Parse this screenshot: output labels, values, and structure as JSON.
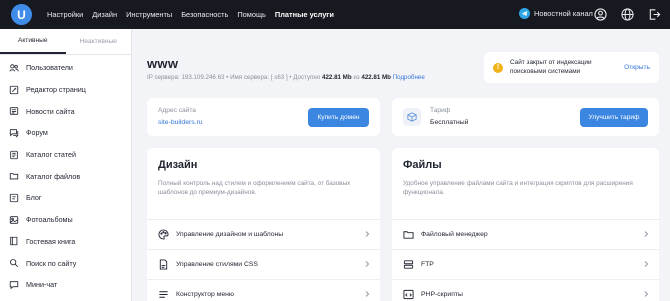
{
  "app": {
    "logo_letter": "U"
  },
  "topnav": {
    "items": [
      "Настройки",
      "Дизайн",
      "Инструменты",
      "Безопасность",
      "Помощь"
    ],
    "paid": "Платные услуги",
    "telegram": "Новостной канал"
  },
  "sidebar": {
    "tab_active": "Активные",
    "tab_inactive": "Неактивные",
    "items": [
      {
        "label": "Пользователи",
        "icon": "users-icon"
      },
      {
        "label": "Редактор страниц",
        "icon": "page-editor-icon"
      },
      {
        "label": "Новости сайта",
        "icon": "news-icon"
      },
      {
        "label": "Форум",
        "icon": "forum-icon"
      },
      {
        "label": "Каталог статей",
        "icon": "articles-icon"
      },
      {
        "label": "Каталог файлов",
        "icon": "files-catalog-icon"
      },
      {
        "label": "Блог",
        "icon": "blog-icon"
      },
      {
        "label": "Фотоальбомы",
        "icon": "photo-icon"
      },
      {
        "label": "Гостевая книга",
        "icon": "guestbook-icon"
      },
      {
        "label": "Поиск по сайту",
        "icon": "search-icon"
      },
      {
        "label": "Мини-чат",
        "icon": "chat-icon"
      }
    ]
  },
  "site": {
    "name": "www",
    "ip_label": "IP сервера:",
    "ip": "193.109.246.63",
    "server_label": "Имя сервера:",
    "server": "[ s63 ]",
    "available_label": "Доступно",
    "available": "422.81 Mb",
    "of": "из",
    "total": "422.81 Mb",
    "more": "Подробнее"
  },
  "notice": {
    "text": "Сайт закрыт от индексации поисковыми системами",
    "action": "Открыть"
  },
  "address": {
    "label": "Адрес сайта",
    "value": "site-builders.ru",
    "button": "Купить домен"
  },
  "tariff": {
    "label": "Тариф",
    "value": "Бесплатный",
    "button": "Улучшить тариф"
  },
  "design": {
    "title": "Дизайн",
    "description": "Полный контроль над стилем и оформлением сайта, от базовых шаблонов до премиум-дизайнов.",
    "rows": [
      "Управление дизайном и шаблоны",
      "Управление стилями CSS",
      "Конструктор меню"
    ]
  },
  "files": {
    "title": "Файлы",
    "description": "Удобное управление файлами сайта и интеграция скриптов для расширения функционала.",
    "rows": [
      "Файловый менеджер",
      "FTP",
      "PHP-скрипты"
    ]
  }
}
